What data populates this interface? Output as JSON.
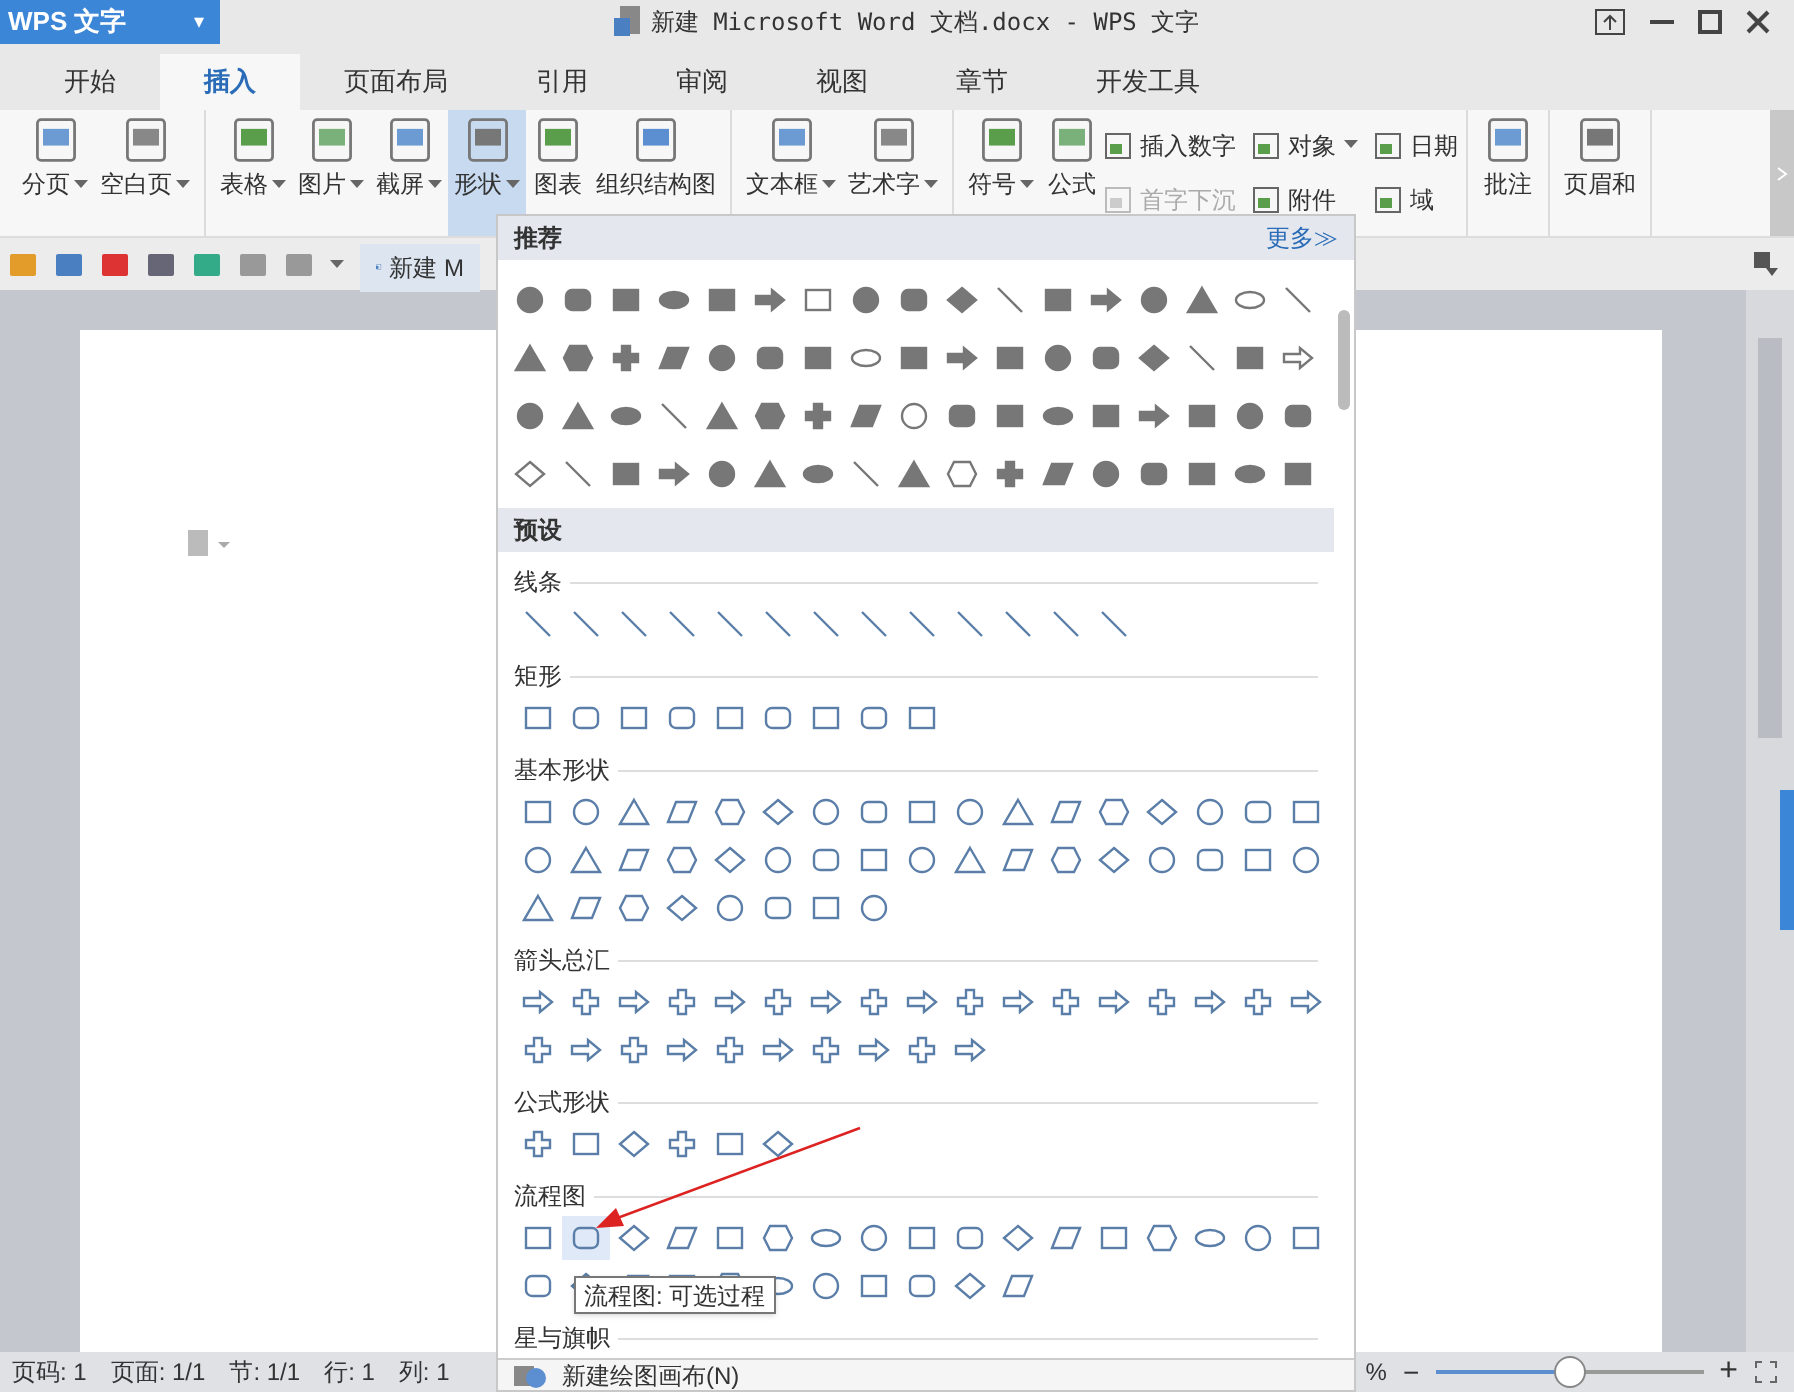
{
  "app_button": {
    "label": "WPS 文字",
    "caret": "▾"
  },
  "window_title": "新建 Microsoft Word 文档.docx - WPS 文字",
  "tabs": [
    {
      "label": "开始",
      "selected": false
    },
    {
      "label": "插入",
      "selected": true
    },
    {
      "label": "页面布局",
      "selected": false
    },
    {
      "label": "引用",
      "selected": false
    },
    {
      "label": "审阅",
      "selected": false
    },
    {
      "label": "视图",
      "selected": false
    },
    {
      "label": "章节",
      "selected": false
    },
    {
      "label": "开发工具",
      "selected": false
    }
  ],
  "ribbon": [
    [
      {
        "kind": "large",
        "label": "分页",
        "dropdown": true,
        "selected": false
      },
      {
        "kind": "large",
        "label": "空白页",
        "dropdown": true,
        "selected": false
      }
    ],
    [
      {
        "kind": "large",
        "label": "表格",
        "dropdown": true,
        "selected": false
      },
      {
        "kind": "large",
        "label": "图片",
        "dropdown": true,
        "selected": false
      },
      {
        "kind": "large",
        "label": "截屏",
        "dropdown": true,
        "selected": false
      },
      {
        "kind": "large",
        "label": "形状",
        "dropdown": true,
        "selected": true
      },
      {
        "kind": "large",
        "label": "图表",
        "dropdown": false,
        "selected": false
      },
      {
        "kind": "large",
        "label": "组织结构图",
        "dropdown": false,
        "selected": false
      }
    ],
    [
      {
        "kind": "large",
        "label": "文本框",
        "dropdown": true,
        "selected": false
      },
      {
        "kind": "large",
        "label": "艺术字",
        "dropdown": true,
        "selected": false
      }
    ],
    [
      {
        "kind": "large",
        "label": "符号",
        "dropdown": true,
        "selected": false
      },
      {
        "kind": "large",
        "label": "公式",
        "dropdown": false,
        "selected": false
      },
      {
        "kind": "small",
        "label": "插入数字",
        "disabled": false,
        "dropdown": false
      },
      {
        "kind": "small",
        "label": "首字下沉",
        "disabled": true,
        "dropdown": false
      },
      {
        "kind": "small",
        "label": "对象",
        "disabled": false,
        "dropdown": true
      },
      {
        "kind": "small",
        "label": "附件",
        "disabled": false,
        "dropdown": false
      },
      {
        "kind": "small",
        "label": "日期",
        "disabled": false,
        "dropdown": false
      },
      {
        "kind": "small",
        "label": "域",
        "disabled": false,
        "dropdown": false
      }
    ],
    [
      {
        "kind": "large",
        "label": "批注",
        "dropdown": false,
        "selected": false
      }
    ],
    [
      {
        "kind": "large",
        "label": "页眉和",
        "dropdown": false,
        "selected": false
      }
    ]
  ],
  "document_tab": {
    "label": "新建 M"
  },
  "shapes_panel": {
    "recommended_title": "推荐",
    "more_link": "更多≫",
    "presets_title": "预设",
    "sections": [
      {
        "title": "线条"
      },
      {
        "title": "矩形"
      },
      {
        "title": "基本形状"
      },
      {
        "title": "箭头总汇"
      },
      {
        "title": "公式形状"
      },
      {
        "title": "流程图"
      },
      {
        "title": "星与旗帜"
      }
    ],
    "tooltip": "流程图: 可选过程",
    "footer_item": "新建绘图画布(N)"
  },
  "status_bar": {
    "items": [
      "页码: 1",
      "页面: 1/1",
      "节: 1/1",
      "行: 1",
      "列: 1"
    ],
    "zoom_percent": "%",
    "zoom_slider": {
      "level": 0.5
    },
    "minus": "−",
    "plus": "+"
  }
}
